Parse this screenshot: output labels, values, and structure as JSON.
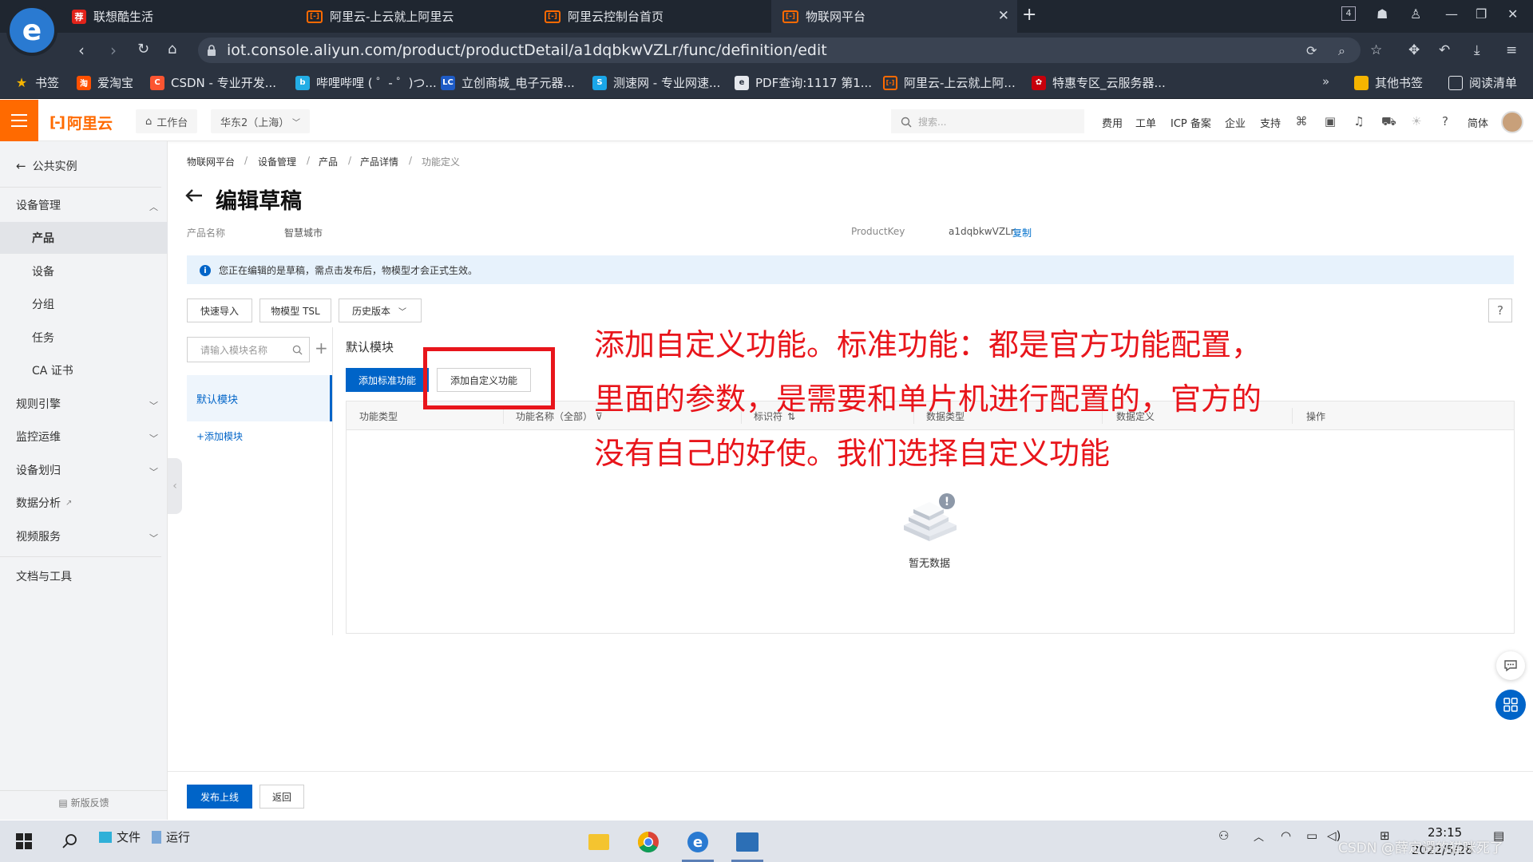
{
  "browser": {
    "tabs": [
      {
        "title": "联想酷生活"
      },
      {
        "title": "阿里云-上云就上阿里云"
      },
      {
        "title": "阿里云控制台首页"
      },
      {
        "title": "物联网平台"
      }
    ],
    "url": "iot.console.aliyun.com/product/productDetail/a1dqbkwVZLr/func/definition/edit",
    "bookmarks": [
      "书签",
      "爱淘宝",
      "CSDN - 专业开发...",
      "哔哩哔哩 ( ゜- ゜)つ...",
      "立创商城_电子元器...",
      "测速网 - 专业网速...",
      "PDF查询:1117 第1...",
      "阿里云-上云就上阿...",
      "特惠专区_云服务器...",
      "其他书签",
      "阅读清单"
    ],
    "tab_count": "4",
    "accent": "#ff6a00"
  },
  "header": {
    "logo": "阿里云",
    "workbench": "工作台",
    "region": "华东2（上海）",
    "search_placeholder": "搜索...",
    "links": [
      "费用",
      "工单",
      "ICP 备案",
      "企业",
      "支持"
    ],
    "lang": "简体"
  },
  "sidebar": {
    "back": "公共实例",
    "group": "设备管理",
    "sub_items": [
      "产品",
      "设备",
      "分组",
      "任务",
      "CA 证书"
    ],
    "items": [
      "规则引擎",
      "监控运维",
      "设备划归",
      "数据分析",
      "视频服务"
    ],
    "docs": "文档与工具",
    "feedback": "新版反馈"
  },
  "breadcrumb": [
    "物联网平台",
    "设备管理",
    "产品",
    "产品详情",
    "功能定义"
  ],
  "page": {
    "title": "编辑草稿",
    "product_name_label": "产品名称",
    "product_name": "智慧城市",
    "product_key_label": "ProductKey",
    "product_key": "a1dqbkwVZLr",
    "copy": "复制",
    "notice": "您正在编辑的是草稿，需点击发布后，物模型才会正式生效。"
  },
  "toolbar": {
    "quick_import": "快速导入",
    "tsl": "物模型 TSL",
    "history": "历史版本",
    "help": "?"
  },
  "modules": {
    "search_placeholder": "请输入模块名称",
    "default": "默认模块",
    "add": "+添加模块",
    "current": "默认模块"
  },
  "actions": {
    "add_standard": "添加标准功能",
    "add_custom": "添加自定义功能"
  },
  "table": {
    "columns": [
      "功能类型",
      "功能名称（全部）",
      "标识符",
      "数据类型",
      "数据定义",
      "操作"
    ],
    "empty": "暂无数据"
  },
  "annotation": {
    "lines": [
      "添加自定义功能。标准功能：都是官方功能配置，",
      "里面的参数，是需要和单片机进行配置的，官方的",
      "没有自己的好使。我们选择自定义功能"
    ],
    "color": "#e8151b"
  },
  "footer": {
    "publish": "发布上线",
    "back": "返回"
  },
  "taskbar": {
    "file": "文件",
    "run": "运行",
    "time": "23:15",
    "date": "2022/5/28",
    "watermark": "CSDN @薛定谔的猫咪死了"
  }
}
